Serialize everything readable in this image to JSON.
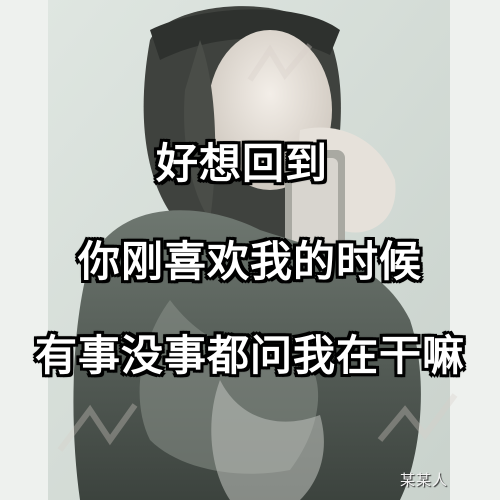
{
  "caption": {
    "line1": "好想回到",
    "line2": "你刚喜欢我的时候",
    "line3": "有事没事都问我在干嘛"
  },
  "signature": "某某人"
}
